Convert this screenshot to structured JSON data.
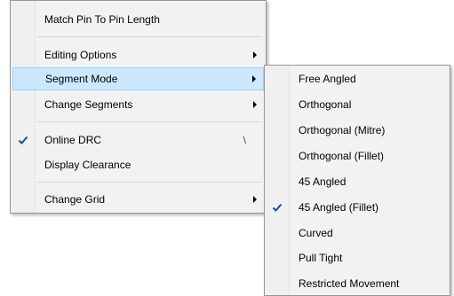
{
  "main_menu": {
    "items": [
      {
        "label": "Match Pin To Pin Length"
      },
      {
        "label": "Editing Options",
        "submenu": true
      },
      {
        "label": "Segment Mode",
        "submenu": true,
        "highlighted": true
      },
      {
        "label": "Change Segments",
        "submenu": true
      },
      {
        "label": "Online DRC",
        "checked": true,
        "shortcut": "\\"
      },
      {
        "label": "Display Clearance"
      },
      {
        "label": "Change Grid",
        "submenu": true
      }
    ]
  },
  "segment_submenu": {
    "items": [
      {
        "label": "Free Angled"
      },
      {
        "label": "Orthogonal"
      },
      {
        "label": "Orthogonal (Mitre)"
      },
      {
        "label": "Orthogonal (Fillet)"
      },
      {
        "label": "45 Angled"
      },
      {
        "label": "45 Angled (Fillet)",
        "checked": true
      },
      {
        "label": "Curved"
      },
      {
        "label": "Pull Tight"
      },
      {
        "label": "Restricted Movement"
      }
    ]
  },
  "colors": {
    "menu_bg": "#f2f2f2",
    "highlight_bg": "#cce8ff",
    "highlight_border": "#99d1ff",
    "check_color": "#1a4f8a"
  },
  "icons": {
    "check": "checkmark-icon",
    "submenu": "submenu-arrow-icon"
  }
}
